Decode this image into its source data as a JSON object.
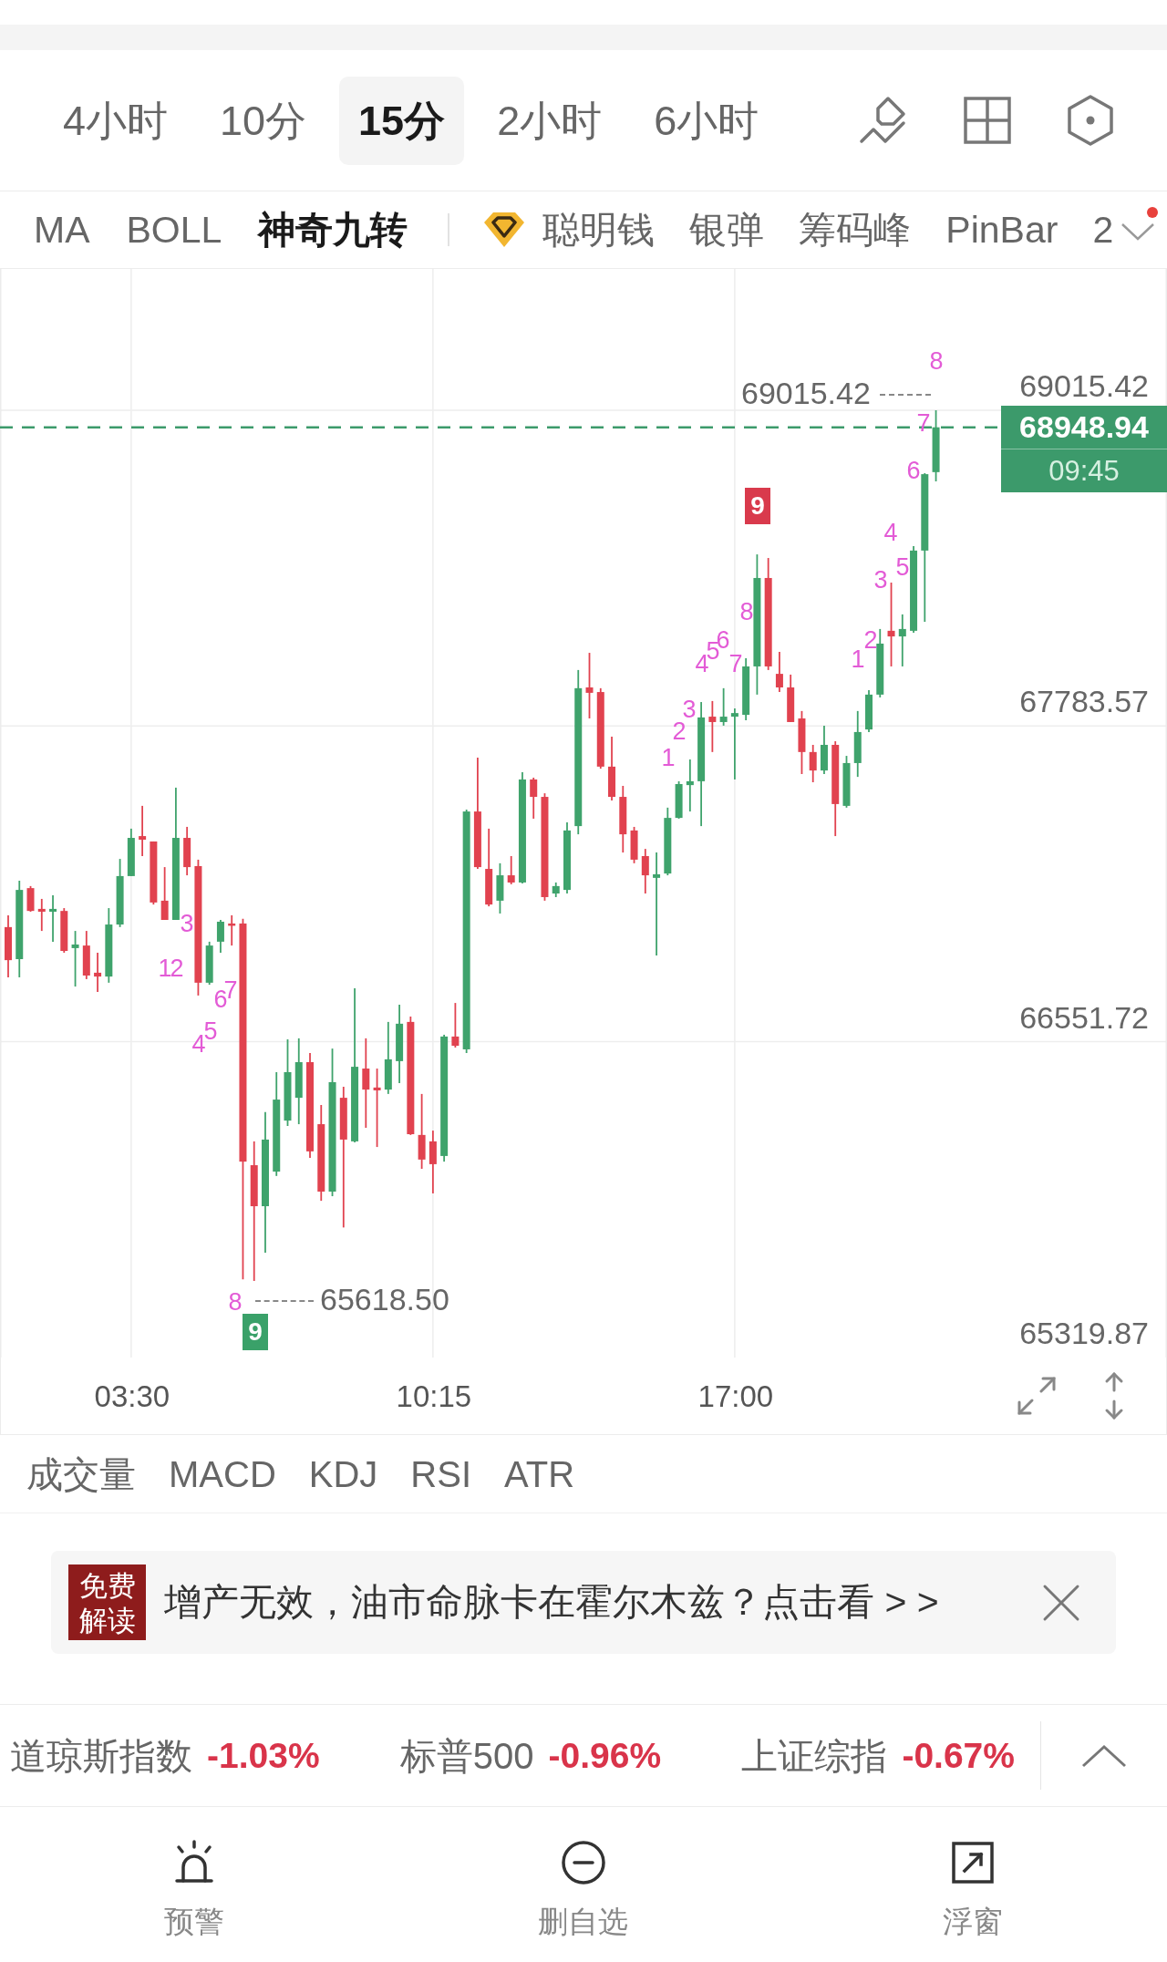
{
  "interval_tabs": [
    {
      "label": "4小时",
      "selected": false
    },
    {
      "label": "10分",
      "selected": false
    },
    {
      "label": "15分",
      "selected": true
    },
    {
      "label": "2小时",
      "selected": false
    },
    {
      "label": "6小时",
      "selected": false
    }
  ],
  "indicators": [
    {
      "label": "MA",
      "selected": false
    },
    {
      "label": "BOLL",
      "selected": false
    },
    {
      "label": "神奇九转",
      "selected": true
    }
  ],
  "premium_indicators": [
    {
      "label": "聪明钱",
      "selected": false
    },
    {
      "label": "银弹",
      "selected": false
    },
    {
      "label": "筹码峰",
      "selected": false
    },
    {
      "label": "PinBar",
      "selected": false
    },
    {
      "label": "2",
      "selected": false
    }
  ],
  "more_button": {
    "notification": true
  },
  "chart": {
    "chart_data": {
      "type": "candlestick",
      "x": [
        0.75,
        1,
        1.25,
        1.5,
        1.75,
        2,
        2.25,
        2.5,
        2.75,
        3,
        3.25,
        3.5,
        3.75,
        4,
        4.25,
        4.5,
        4.75,
        5,
        5.25,
        5.5,
        5.75,
        6,
        6.25,
        6.5,
        6.75,
        7,
        7.25,
        7.5,
        7.75,
        8,
        8.25,
        8.5,
        8.75,
        9,
        9.25,
        9.5,
        9.75,
        10,
        10.25,
        10.5,
        10.75,
        11,
        11.25,
        11.5,
        11.75,
        12,
        12.25,
        12.5,
        12.75,
        13,
        13.25,
        13.5,
        13.75,
        14,
        14.25,
        14.5,
        14.75,
        15,
        15.25,
        15.5,
        15.75,
        16,
        16.25,
        16.5,
        16.75,
        17,
        17.25,
        17.5,
        17.75,
        18,
        18.25,
        18.5,
        18.75,
        19,
        19.25,
        19.5,
        19.75,
        20,
        20.25,
        20.5,
        20.75,
        21,
        21.25,
        21.5
      ],
      "ohlc": [
        [
          66999,
          67045,
          66803,
          66870
        ],
        [
          66874,
          67180,
          66803,
          67144
        ],
        [
          67151,
          67159,
          67059,
          67062
        ],
        [
          67070,
          67109,
          66984,
          67059
        ],
        [
          67059,
          67123,
          66942,
          67070
        ],
        [
          67062,
          67073,
          66899,
          66906
        ],
        [
          66917,
          66984,
          66767,
          66931
        ],
        [
          66927,
          66984,
          66796,
          66810
        ],
        [
          66821,
          66899,
          66746,
          66806
        ],
        [
          66806,
          67073,
          66782,
          67009
        ],
        [
          67009,
          67265,
          66999,
          67198
        ],
        [
          67198,
          67383,
          67198,
          67347
        ],
        [
          67354,
          67472,
          67276,
          67340
        ],
        [
          67333,
          67333,
          67087,
          67095
        ],
        [
          67102,
          67233,
          67027,
          67027
        ],
        [
          67027,
          67543,
          67027,
          67347
        ],
        [
          67347,
          67390,
          67201,
          67233
        ],
        [
          67237,
          67262,
          66732,
          66782
        ],
        [
          66782,
          66942,
          66774,
          66927
        ],
        [
          66942,
          67027,
          66899,
          67020
        ],
        [
          67013,
          67045,
          66927,
          67006
        ],
        [
          67013,
          67031,
          65625,
          66084
        ],
        [
          66070,
          66163,
          65618.5,
          65910
        ],
        [
          65910,
          66277,
          65729,
          66170
        ],
        [
          66045,
          66433,
          66028,
          66326
        ],
        [
          66244,
          66561,
          66223,
          66433
        ],
        [
          66333,
          66565,
          66230,
          66472
        ],
        [
          66472,
          66508,
          66099,
          66124
        ],
        [
          66230,
          66305,
          65931,
          65967
        ],
        [
          65967,
          66525,
          65949,
          66394
        ],
        [
          66333,
          66376,
          65827,
          66170
        ],
        [
          66163,
          66760,
          66159,
          66454
        ],
        [
          66447,
          66565,
          66216,
          66365
        ],
        [
          66373,
          66447,
          66141,
          66362
        ],
        [
          66365,
          66629,
          66348,
          66483
        ],
        [
          66476,
          66696,
          66390,
          66622
        ],
        [
          66629,
          66650,
          66188,
          66191
        ],
        [
          66188,
          66348,
          66056,
          66092
        ],
        [
          66163,
          66205,
          65960,
          66074
        ],
        [
          66106,
          66579,
          66084,
          66572
        ],
        [
          66572,
          66703,
          66529,
          66536
        ],
        [
          66522,
          67457,
          66508,
          67450
        ],
        [
          67450,
          67660,
          67226,
          67233
        ],
        [
          67226,
          67383,
          67080,
          67087
        ],
        [
          67102,
          67248,
          67052,
          67201
        ],
        [
          67201,
          67276,
          67166,
          67173
        ],
        [
          67173,
          67603,
          67169,
          67575
        ],
        [
          67575,
          67582,
          67422,
          67507
        ],
        [
          67507,
          67521,
          67102,
          67116
        ],
        [
          67130,
          67173,
          67116,
          67159
        ],
        [
          67144,
          67408,
          67130,
          67376
        ],
        [
          67393,
          68002,
          67361,
          67931
        ],
        [
          67934,
          68069,
          67813,
          67913
        ],
        [
          67916,
          67931,
          67617,
          67625
        ],
        [
          67625,
          67742,
          67493,
          67507
        ],
        [
          67507,
          67550,
          67290,
          67361
        ],
        [
          67376,
          67390,
          67248,
          67262
        ],
        [
          67276,
          67304,
          67130,
          67201
        ],
        [
          67191,
          67290,
          66888,
          67205
        ],
        [
          67208,
          67465,
          67201,
          67425
        ],
        [
          67425,
          67568,
          67422,
          67557
        ],
        [
          67553,
          67653,
          67450,
          67568
        ],
        [
          67568,
          67877,
          67393,
          67817
        ],
        [
          67820,
          67881,
          67682,
          67799
        ],
        [
          67799,
          67931,
          67785,
          67820
        ],
        [
          67820,
          67852,
          67575,
          67834
        ],
        [
          67827,
          68048,
          67806,
          68016
        ],
        [
          68016,
          68453,
          67906,
          68361
        ],
        [
          68361,
          68439,
          68002,
          68016
        ],
        [
          67987,
          68073,
          67916,
          67934
        ],
        [
          67934,
          67984,
          67799,
          67799
        ],
        [
          67813,
          67842,
          67596,
          67682
        ],
        [
          67682,
          67710,
          67564,
          67610
        ],
        [
          67610,
          67785,
          67596,
          67710
        ],
        [
          67710,
          67724,
          67354,
          67479
        ],
        [
          67472,
          67667,
          67465,
          67639
        ],
        [
          67639,
          67842,
          67585,
          67760
        ],
        [
          67770,
          67923,
          67760,
          67906
        ],
        [
          67906,
          68162,
          67895,
          68105
        ],
        [
          68155,
          68343,
          68016,
          68133
        ],
        [
          68133,
          68219,
          68016,
          68162
        ],
        [
          68155,
          68485,
          68147,
          68468
        ],
        [
          68468,
          68770,
          68190,
          68766
        ],
        [
          68774,
          69015.42,
          68738,
          68948.94
        ]
      ],
      "xlim": [
        0.5665,
        26.668
      ],
      "ylim": [
        65319.6,
        69566.7
      ],
      "xticks": [
        {
          "value": 3.5,
          "label": "03:30"
        },
        {
          "value": 10.25,
          "label": "10:15"
        },
        {
          "value": 17,
          "label": "17:00"
        }
      ],
      "yticks": [
        {
          "value": 69015.42,
          "label": "69015.42"
        },
        {
          "value": 67783.57,
          "label": "67783.57"
        },
        {
          "value": 66551.72,
          "label": "66551.72"
        },
        {
          "value": 65319.87,
          "label": "65319.87"
        }
      ],
      "grid": true,
      "ref_lines": [
        {
          "axis": "y",
          "value": 68948.94,
          "label": "68948.94",
          "color": "#3c9a6b"
        }
      ]
    },
    "countdown": "09:45",
    "high_label": "69015.42",
    "low_label": "65618.50",
    "td_markers": [
      {
        "kind": "count",
        "text": "1",
        "color": "#e35bd6"
      },
      {
        "kind": "count",
        "text": "2",
        "color": "#e35bd6"
      },
      {
        "kind": "count",
        "text": "3",
        "color": "#e35bd6"
      },
      {
        "kind": "count",
        "text": "4",
        "color": "#e35bd6"
      },
      {
        "kind": "count",
        "text": "5",
        "color": "#e35bd6"
      },
      {
        "kind": "count",
        "text": "6",
        "color": "#e35bd6"
      },
      {
        "kind": "count",
        "text": "7",
        "color": "#e35bd6"
      },
      {
        "kind": "count",
        "text": "8",
        "color": "#e35bd6"
      },
      {
        "kind": "signal",
        "text": "9",
        "color": "#3aa169"
      },
      {
        "kind": "count",
        "text": "1",
        "color": "#e35bd6"
      },
      {
        "kind": "count",
        "text": "2",
        "color": "#e35bd6"
      },
      {
        "kind": "count",
        "text": "3",
        "color": "#e35bd6"
      },
      {
        "kind": "count",
        "text": "4",
        "color": "#e35bd6"
      },
      {
        "kind": "count",
        "text": "5",
        "color": "#e35bd6"
      },
      {
        "kind": "count",
        "text": "6",
        "color": "#e35bd6"
      },
      {
        "kind": "count",
        "text": "7",
        "color": "#e35bd6"
      },
      {
        "kind": "count",
        "text": "8",
        "color": "#e35bd6"
      },
      {
        "kind": "signal",
        "text": "9",
        "color": "#d93a4c"
      },
      {
        "kind": "count",
        "text": "1",
        "color": "#e35bd6"
      },
      {
        "kind": "count",
        "text": "2",
        "color": "#e35bd6"
      },
      {
        "kind": "count",
        "text": "3",
        "color": "#e35bd6"
      },
      {
        "kind": "count",
        "text": "4",
        "color": "#e35bd6"
      },
      {
        "kind": "count",
        "text": "5",
        "color": "#e35bd6"
      },
      {
        "kind": "count",
        "text": "6",
        "color": "#e35bd6"
      },
      {
        "kind": "count",
        "text": "7",
        "color": "#e35bd6"
      },
      {
        "kind": "count",
        "text": "8",
        "color": "#e35bd6"
      }
    ]
  },
  "sub_indicators": [
    {
      "label": "成交量",
      "selected": false
    },
    {
      "label": "MACD",
      "selected": false
    },
    {
      "label": "KDJ",
      "selected": false
    },
    {
      "label": "RSI",
      "selected": false
    },
    {
      "label": "ATR",
      "selected": false
    }
  ],
  "banner": {
    "badge": "免费解读",
    "text": "增产无效，油市命脉卡在霍尔木兹？点击看 > >"
  },
  "tickers": [
    {
      "name": "道琼斯指数",
      "change": "-1.03%",
      "falling": true
    },
    {
      "name": "标普500",
      "change": "-0.96%",
      "falling": true
    },
    {
      "name": "上证综指",
      "change": "-0.67%",
      "falling": true
    }
  ],
  "bottom_nav": [
    {
      "label": "预警"
    },
    {
      "label": "删自选"
    },
    {
      "label": "浮窗"
    }
  ]
}
